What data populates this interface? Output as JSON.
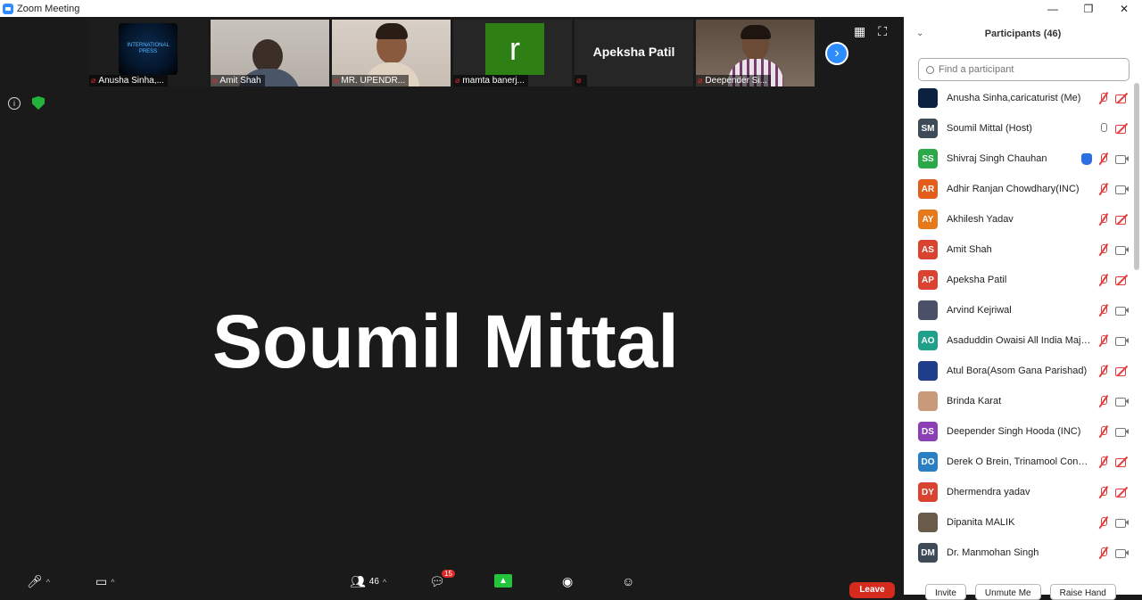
{
  "window": {
    "title": "Zoom Meeting",
    "minimize": "—",
    "maximize": "❐",
    "close": "✕"
  },
  "strip": {
    "tiles": [
      {
        "name": "Anusha Sinha,...",
        "kind": "logo",
        "logo_text": "INTERNATIONAL PRESS"
      },
      {
        "name": "Amit Shah",
        "kind": "person"
      },
      {
        "name": "MR. UPENDR...",
        "kind": "person"
      },
      {
        "name": "mamta banerj...",
        "kind": "avatar",
        "avatar_letter": "r",
        "avatar_color": "#2f8014"
      },
      {
        "name": "",
        "kind": "name",
        "big_name": "Apeksha Patil"
      },
      {
        "name": "Deepender Si...",
        "kind": "person"
      }
    ],
    "next_icon": "chevron-right-icon"
  },
  "active_speaker": "Soumil Mittal",
  "toolbar": {
    "participants_count": "46",
    "chat_badge": "15",
    "leave_label": "Leave"
  },
  "panel": {
    "title": "Participants (46)",
    "search_placeholder": "Find a participant",
    "participants": [
      {
        "initials": "",
        "name": "Anusha Sinha,caricaturist (Me)",
        "color": "#0b2140",
        "mic": "off",
        "cam": "off",
        "hand": false,
        "photo": true
      },
      {
        "initials": "SM",
        "name": "Soumil Mittal (Host)",
        "color": "#3f4a58",
        "mic": "on",
        "cam": "off",
        "hand": false
      },
      {
        "initials": "SS",
        "name": "Shivraj Singh Chauhan",
        "color": "#2aa84a",
        "mic": "off",
        "cam": "on",
        "hand": true
      },
      {
        "initials": "AR",
        "name": "Adhir Ranjan Chowdhary(INC)",
        "color": "#e35e1a",
        "mic": "off",
        "cam": "on",
        "hand": false
      },
      {
        "initials": "AY",
        "name": "Akhilesh Yadav",
        "color": "#e67a1a",
        "mic": "off",
        "cam": "off",
        "hand": false
      },
      {
        "initials": "AS",
        "name": "Amit Shah",
        "color": "#d9432f",
        "mic": "off",
        "cam": "on",
        "hand": false
      },
      {
        "initials": "AP",
        "name": "Apeksha Patil",
        "color": "#d9432f",
        "mic": "off",
        "cam": "off",
        "hand": false
      },
      {
        "initials": "",
        "name": "Arvind Kejriwal",
        "color": "#4a4f6a",
        "mic": "off",
        "cam": "on",
        "hand": false,
        "photo": true
      },
      {
        "initials": "AO",
        "name": "Asaduddin Owaisi  All India Majli...",
        "color": "#1fa08a",
        "mic": "off",
        "cam": "on",
        "hand": false
      },
      {
        "initials": "",
        "name": "Atul Bora(Asom Gana Parishad)",
        "color": "#1f3d8a",
        "mic": "off",
        "cam": "off",
        "hand": false,
        "photo": true
      },
      {
        "initials": "",
        "name": "Brinda Karat",
        "color": "#c99a7a",
        "mic": "off",
        "cam": "on",
        "hand": false,
        "photo": true
      },
      {
        "initials": "DS",
        "name": "Deepender Singh Hooda (INC)",
        "color": "#8a3fb4",
        "mic": "off",
        "cam": "on",
        "hand": false
      },
      {
        "initials": "DO",
        "name": "Derek O Brein, Trinamool Congre...",
        "color": "#2a7fc4",
        "mic": "off",
        "cam": "off",
        "hand": false
      },
      {
        "initials": "DY",
        "name": "Dhermendra yadav",
        "color": "#d9432f",
        "mic": "off",
        "cam": "off",
        "hand": false
      },
      {
        "initials": "",
        "name": "Dipanita MALIK",
        "color": "#6a5a4a",
        "mic": "off",
        "cam": "on",
        "hand": false,
        "photo": true
      },
      {
        "initials": "DM",
        "name": "Dr. Manmohan Singh",
        "color": "#3f4a58",
        "mic": "off",
        "cam": "on",
        "hand": false
      }
    ],
    "footer": {
      "invite": "Invite",
      "unmute_me": "Unmute Me",
      "raise_hand": "Raise Hand"
    }
  }
}
